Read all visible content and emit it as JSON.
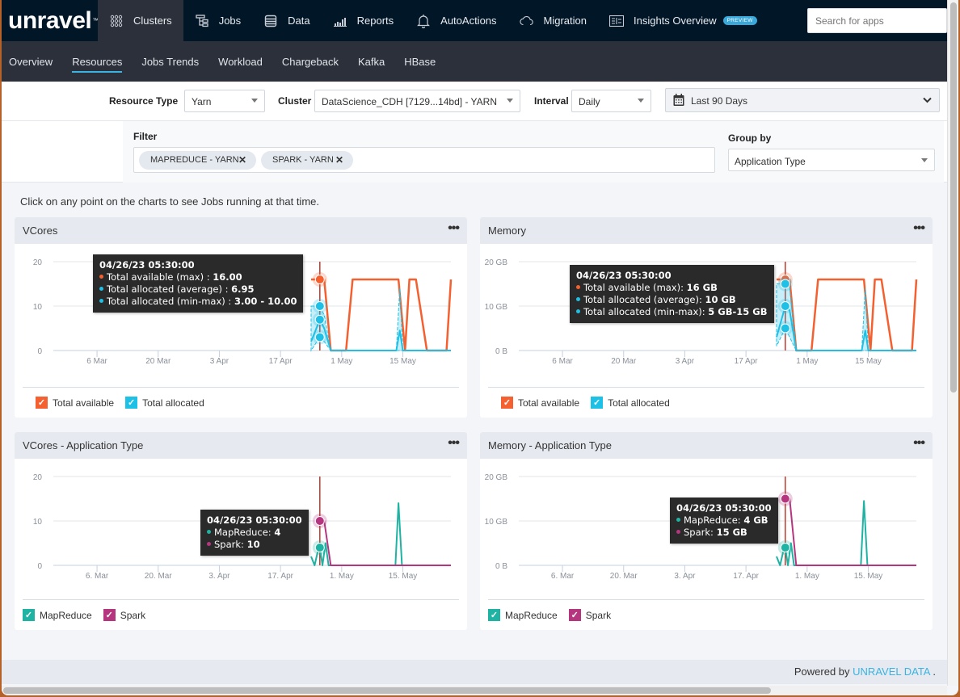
{
  "app": {
    "logo": "unravel",
    "logo_tm": "™"
  },
  "topnav": {
    "items": [
      {
        "label": "Clusters",
        "icon": "clusters-icon",
        "active": true
      },
      {
        "label": "Jobs",
        "icon": "jobs-icon"
      },
      {
        "label": "Data",
        "icon": "database-icon"
      },
      {
        "label": "Reports",
        "icon": "bar-chart-icon"
      },
      {
        "label": "AutoActions",
        "icon": "bell-icon"
      },
      {
        "label": "Migration",
        "icon": "cloud-icon"
      },
      {
        "label": "Insights Overview",
        "icon": "insights-icon",
        "badge": "PREVIEW"
      }
    ],
    "search_placeholder": "Search for apps"
  },
  "subnav": {
    "items": [
      {
        "label": "Overview"
      },
      {
        "label": "Resources",
        "active": true
      },
      {
        "label": "Jobs Trends"
      },
      {
        "label": "Workload"
      },
      {
        "label": "Chargeback"
      },
      {
        "label": "Kafka"
      },
      {
        "label": "HBase"
      }
    ]
  },
  "toolbar": {
    "resource_type_label": "Resource Type",
    "resource_type_value": "Yarn",
    "cluster_label": "Cluster",
    "cluster_value": "DataScience_CDH [7129...14bd] - YARN",
    "interval_label": "Interval",
    "interval_value": "Daily",
    "date_range_value": "Last 90 Days"
  },
  "filter": {
    "label": "Filter",
    "chips": [
      "MAPREDUCE - YARN",
      "SPARK - YARN"
    ],
    "group_by_label": "Group by",
    "group_by_value": "Application Type"
  },
  "hint": "Click on any point on the charts to see Jobs running at that time.",
  "colors": {
    "available": "#f4602f",
    "allocated": "#1ec0e6",
    "mapreduce": "#1fb3a3",
    "spark": "#b5367e",
    "crosshair": "#c0392b"
  },
  "chart_data": [
    {
      "id": "vcores",
      "type": "line",
      "title": "VCores",
      "xlabel": "",
      "ylabel": "",
      "x_ticks": [
        "6 Mar",
        "20 Mar",
        "3 Apr",
        "17 Apr",
        "1 May",
        "15 May"
      ],
      "x_domain_days_from_24_Feb": [
        0,
        91
      ],
      "y_ticks": [
        "0",
        "10",
        "20"
      ],
      "ylim": [
        0,
        20
      ],
      "grid": true,
      "legend": "bottom-left",
      "series": [
        {
          "name": "Total available",
          "color_key": "available",
          "x": [
            59,
            62,
            63.5,
            67,
            68.5,
            79,
            80.5,
            81.5,
            83,
            85.5,
            90,
            91
          ],
          "values": [
            16,
            16,
            0,
            0,
            16,
            16,
            0,
            16,
            16,
            0,
            0,
            16
          ]
        },
        {
          "name": "Total allocated",
          "color_key": "allocated",
          "x": [
            59,
            61,
            62,
            63.5,
            78.5,
            79.3,
            80,
            91
          ],
          "values": [
            2,
            6.95,
            5,
            0,
            0,
            4.5,
            0,
            0
          ],
          "range_low": [
            0,
            3,
            2,
            0,
            0,
            0,
            0,
            0
          ],
          "range_high": [
            10,
            10,
            8,
            0,
            0,
            14,
            0,
            0
          ]
        }
      ],
      "tooltip": {
        "title": "04/26/23 05:30:00",
        "rows": [
          {
            "label": "Total available (max) : ",
            "value": "16.00",
            "color_key": "available"
          },
          {
            "label": "Total allocated (average) : ",
            "value": "6.95",
            "color_key": "allocated"
          },
          {
            "label": "Total allocated (min-max) : ",
            "value": "3.00 - 10.00",
            "color_key": "allocated"
          }
        ]
      },
      "crosshair_day": 61
    },
    {
      "id": "memory",
      "type": "line",
      "title": "Memory",
      "x_ticks": [
        "6 Mar",
        "20 Mar",
        "3 Apr",
        "17 Apr",
        "1 May",
        "15 May"
      ],
      "x_domain_days_from_24_Feb": [
        0,
        91
      ],
      "y_ticks": [
        "0 B",
        "10 GB",
        "20 GB"
      ],
      "ylim": [
        0,
        20
      ],
      "grid": true,
      "legend": "bottom-left",
      "series": [
        {
          "name": "Total available",
          "color_key": "available",
          "x": [
            59,
            62,
            63.5,
            67,
            68.5,
            79,
            80.5,
            81.5,
            83,
            85.5,
            90,
            91
          ],
          "values": [
            16,
            16,
            0,
            0,
            16,
            16,
            0,
            16,
            16,
            0,
            0,
            16
          ]
        },
        {
          "name": "Total allocated",
          "color_key": "allocated",
          "x": [
            59,
            61,
            62,
            63.5,
            78.5,
            79.3,
            80,
            91
          ],
          "values": [
            3,
            10,
            9,
            0,
            0,
            4.5,
            0,
            0
          ],
          "range_low": [
            1,
            5,
            3,
            0,
            0,
            0,
            0,
            0
          ],
          "range_high": [
            15,
            15,
            14,
            0,
            0,
            14,
            0,
            0
          ]
        }
      ],
      "tooltip": {
        "title": "04/26/23 05:30:00",
        "rows": [
          {
            "label": "Total available (max): ",
            "value": "16 GB",
            "color_key": "available"
          },
          {
            "label": "Total allocated (average): ",
            "value": "10 GB",
            "color_key": "allocated"
          },
          {
            "label": "Total allocated (min-max): ",
            "value": "5 GB-15 GB",
            "color_key": "allocated"
          }
        ]
      },
      "crosshair_day": 61
    },
    {
      "id": "vcores-app",
      "type": "line",
      "title": "VCores - Application Type",
      "x_ticks": [
        "6. Mar",
        "20. Mar",
        "3. Apr",
        "17. Apr",
        "1. May",
        "15. May"
      ],
      "x_domain_days_from_24_Feb": [
        0,
        91
      ],
      "y_ticks": [
        "0",
        "10",
        "20"
      ],
      "ylim": [
        0,
        20
      ],
      "grid": true,
      "legend": "bottom-left",
      "series": [
        {
          "name": "MapReduce",
          "color_key": "mapreduce",
          "x": [
            59,
            59.8,
            60.5,
            61,
            61.6,
            62.3,
            63,
            63.5,
            78.3,
            79,
            79.8,
            91
          ],
          "values": [
            2,
            0,
            3,
            4,
            0,
            5,
            0,
            0,
            0,
            14,
            0,
            0
          ]
        },
        {
          "name": "Spark",
          "color_key": "spark",
          "x": [
            60,
            61,
            62,
            63.5,
            91
          ],
          "values": [
            10,
            10,
            10,
            0,
            0
          ]
        }
      ],
      "tooltip": {
        "title": "04/26/23 05:30:00",
        "rows": [
          {
            "label": "MapReduce: ",
            "value": "4",
            "color_key": "mapreduce"
          },
          {
            "label": "Spark: ",
            "value": "10",
            "color_key": "spark"
          }
        ]
      },
      "crosshair_day": 61
    },
    {
      "id": "memory-app",
      "type": "line",
      "title": "Memory - Application Type",
      "x_ticks": [
        "6. Mar",
        "20. Mar",
        "3. Apr",
        "17. Apr",
        "1. May",
        "15. May"
      ],
      "x_domain_days_from_24_Feb": [
        0,
        91
      ],
      "y_ticks": [
        "0 B",
        "10 GB",
        "20 GB"
      ],
      "ylim": [
        0,
        20
      ],
      "grid": true,
      "legend": "bottom-left",
      "series": [
        {
          "name": "MapReduce",
          "color_key": "mapreduce",
          "x": [
            59,
            59.8,
            60.5,
            61,
            61.6,
            62.3,
            63,
            63.5,
            78.3,
            79,
            79.8,
            91
          ],
          "values": [
            2,
            0,
            3,
            4,
            0,
            5,
            0,
            0,
            0,
            14.5,
            0,
            0
          ]
        },
        {
          "name": "Spark",
          "color_key": "spark",
          "x": [
            60,
            61,
            62,
            63.5,
            91
          ],
          "values": [
            15,
            15,
            15,
            0,
            0
          ]
        }
      ],
      "tooltip": {
        "title": "04/26/23 05:30:00",
        "rows": [
          {
            "label": "MapReduce: ",
            "value": "4 GB",
            "color_key": "mapreduce"
          },
          {
            "label": "Spark: ",
            "value": "15 GB",
            "color_key": "spark"
          }
        ]
      },
      "crosshair_day": 61
    }
  ],
  "footer": {
    "powered_by": "Powered by ",
    "brand": "UNRAVEL DATA",
    "suffix": " ."
  }
}
